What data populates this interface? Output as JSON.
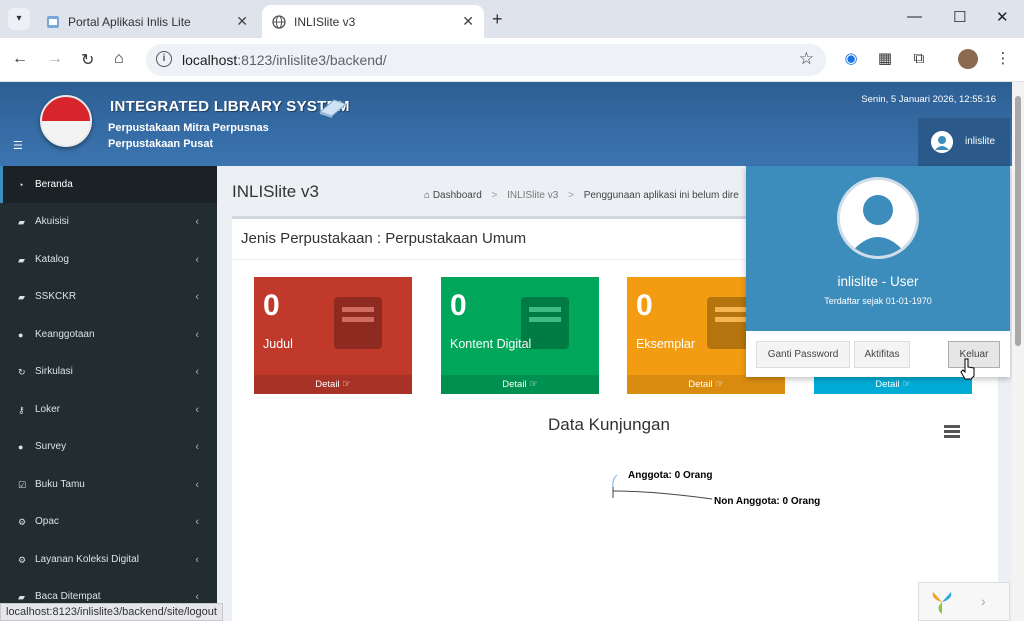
{
  "browser": {
    "tabs": [
      {
        "title": "Portal Aplikasi Inlis Lite",
        "active": false
      },
      {
        "title": "INLISlite v3",
        "active": true
      }
    ],
    "url_host": "localhost",
    "url_path": ":8123/inlislite3/backend/",
    "status_url": "localhost:8123/inlislite3/backend/site/logout"
  },
  "header": {
    "system_title": "INTEGRATED LIBRARY SYSTEM",
    "library_name": "Perpustakaan Mitra Perpusnas",
    "library_unit": "Perpustakaan Pusat",
    "datetime": "Senin, 5 Januari 2026, 12:55:16",
    "username": "inlislite"
  },
  "sidebar": {
    "items": [
      {
        "label": "Beranda",
        "icon": "dashboard-icon"
      },
      {
        "label": "Akuisisi",
        "icon": "book-icon"
      },
      {
        "label": "Katalog",
        "icon": "book-icon"
      },
      {
        "label": "SSKCKR",
        "icon": "book-icon"
      },
      {
        "label": "Keanggotaan",
        "icon": "user-icon"
      },
      {
        "label": "Sirkulasi",
        "icon": "refresh-icon"
      },
      {
        "label": "Loker",
        "icon": "key-icon"
      },
      {
        "label": "Survey",
        "icon": "users-icon"
      },
      {
        "label": "Buku Tamu",
        "icon": "check-icon"
      },
      {
        "label": "Opac",
        "icon": "gears-icon"
      },
      {
        "label": "Layanan Koleksi Digital",
        "icon": "gears-icon"
      },
      {
        "label": "Baca Ditempat",
        "icon": "book-icon"
      }
    ]
  },
  "content": {
    "page_title": "INLISlite v3",
    "breadcrumb": {
      "home": "Dashboard",
      "app": "INLISlite v3",
      "current": "Penggunaan aplikasi ini belum dire"
    },
    "panel_title": "Jenis Perpustakaan : Perpustakaan Umum",
    "stats": [
      {
        "value": "0",
        "label": "Judul",
        "detail": "Detail",
        "color": "#c0392b",
        "foot_color": "#a93226"
      },
      {
        "value": "0",
        "label": "Kontent Digital",
        "detail": "Detail",
        "color": "#00a65a",
        "foot_color": "#009150"
      },
      {
        "value": "0",
        "label": "Eksemplar",
        "detail": "Detail",
        "color": "#f39c12",
        "foot_color": "#da8c10"
      },
      {
        "value": "",
        "label": "",
        "detail": "Detail",
        "color": "#00c0ef",
        "foot_color": "#00acd6"
      }
    ],
    "chart_title": "Data Kunjungan",
    "pie_labels": {
      "anggota": "Anggota: 0 Orang",
      "non_anggota": "Non Anggota: 0 Orang"
    }
  },
  "dropdown": {
    "user_title": "inlislite - User",
    "registered": "Terdaftar sejak 01-01-1970",
    "buttons": {
      "change_password": "Ganti Password",
      "activity": "Aktifitas",
      "logout": "Keluar"
    }
  },
  "colors": {
    "header": "#3c75b1",
    "sidebar": "#222d32",
    "dropdown_head": "#3c8dbc"
  }
}
